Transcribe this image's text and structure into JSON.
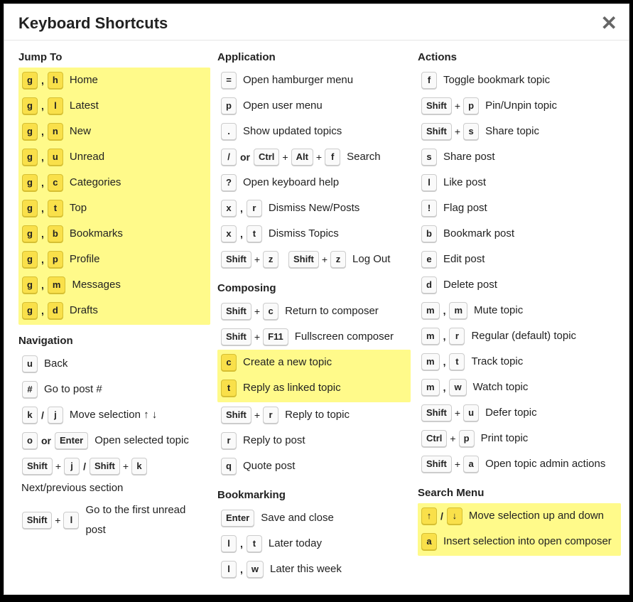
{
  "dialog": {
    "title": "Keyboard Shortcuts"
  },
  "sections": {
    "jumpTo": {
      "title": "Jump To",
      "rows": [
        {
          "keys": [
            [
              "g"
            ],
            [
              ","
            ],
            [
              "h"
            ]
          ],
          "desc": "Home",
          "hl": true
        },
        {
          "keys": [
            [
              "g"
            ],
            [
              ","
            ],
            [
              "l"
            ]
          ],
          "desc": "Latest",
          "hl": true
        },
        {
          "keys": [
            [
              "g"
            ],
            [
              ","
            ],
            [
              "n"
            ]
          ],
          "desc": "New",
          "hl": true
        },
        {
          "keys": [
            [
              "g"
            ],
            [
              ","
            ],
            [
              "u"
            ]
          ],
          "desc": "Unread",
          "hl": true
        },
        {
          "keys": [
            [
              "g"
            ],
            [
              ","
            ],
            [
              "c"
            ]
          ],
          "desc": "Categories",
          "hl": true
        },
        {
          "keys": [
            [
              "g"
            ],
            [
              ","
            ],
            [
              "t"
            ]
          ],
          "desc": "Top",
          "hl": true
        },
        {
          "keys": [
            [
              "g"
            ],
            [
              ","
            ],
            [
              "b"
            ]
          ],
          "desc": "Bookmarks",
          "hl": true
        },
        {
          "keys": [
            [
              "g"
            ],
            [
              ","
            ],
            [
              "p"
            ]
          ],
          "desc": "Profile",
          "hl": true
        },
        {
          "keys": [
            [
              "g"
            ],
            [
              ","
            ],
            [
              "m"
            ]
          ],
          "desc": "Messages",
          "hl": true
        },
        {
          "keys": [
            [
              "g"
            ],
            [
              ","
            ],
            [
              "d"
            ]
          ],
          "desc": "Drafts",
          "hl": true
        }
      ]
    },
    "navigation": {
      "title": "Navigation",
      "back": {
        "key": "u",
        "desc": "Back"
      },
      "goToPost": {
        "key": "#",
        "desc": "Go to post #"
      },
      "moveSel": {
        "k": "k",
        "j": "j",
        "slash": "/",
        "desc": "Move selection ↑ ↓"
      },
      "openSel": {
        "o": "o",
        "or": "or",
        "enter": "Enter",
        "desc": "Open selected topic"
      },
      "nextPrev": {
        "shift": "Shift",
        "plus": "+",
        "j": "j",
        "slash": "/",
        "k": "k",
        "desc": "Next/previous section"
      },
      "firstUnread": {
        "shift": "Shift",
        "plus": "+",
        "l": "l",
        "desc": "Go to the first unread post"
      }
    },
    "application": {
      "title": "Application",
      "rows": [
        {
          "k": "=",
          "desc": "Open hamburger menu"
        },
        {
          "k": "p",
          "desc": "Open user menu"
        },
        {
          "k": ".",
          "desc": "Show updated topics"
        }
      ],
      "search": {
        "slash": "/",
        "or": "or",
        "ctrl": "Ctrl",
        "plus": "+",
        "alt": "Alt",
        "f": "f",
        "desc": "Search"
      },
      "help": {
        "k": "?",
        "desc": "Open keyboard help"
      },
      "dismissNew": {
        "x": "x",
        "comma": ",",
        "r": "r",
        "desc": "Dismiss New/Posts"
      },
      "dismissTopics": {
        "x": "x",
        "comma": ",",
        "t": "t",
        "desc": "Dismiss Topics"
      },
      "logout": {
        "shift": "Shift",
        "plus": "+",
        "z": "z",
        "desc": "Log Out"
      }
    },
    "composing": {
      "title": "Composing",
      "returnComposer": {
        "shift": "Shift",
        "plus": "+",
        "c": "c",
        "desc": "Return to composer"
      },
      "fullscreen": {
        "shift": "Shift",
        "plus": "+",
        "f11": "F11",
        "desc": "Fullscreen composer"
      },
      "createTopic": {
        "k": "c",
        "desc": "Create a new topic",
        "hl": true
      },
      "replyLinked": {
        "k": "t",
        "desc": "Reply as linked topic",
        "hl": true
      },
      "replyTopic": {
        "shift": "Shift",
        "plus": "+",
        "r": "r",
        "desc": "Reply to topic"
      },
      "replyPost": {
        "k": "r",
        "desc": "Reply to post"
      },
      "quotePost": {
        "k": "q",
        "desc": "Quote post"
      }
    },
    "bookmarking": {
      "title": "Bookmarking",
      "saveClose": {
        "enter": "Enter",
        "desc": "Save and close"
      },
      "laterToday": {
        "l": "l",
        "comma": ",",
        "t": "t",
        "desc": "Later today"
      },
      "laterWeek": {
        "l": "l",
        "comma": ",",
        "w": "w",
        "desc": "Later this week"
      }
    },
    "actions": {
      "title": "Actions",
      "toggleBookmark": {
        "k": "f",
        "desc": "Toggle bookmark topic"
      },
      "pinUnpin": {
        "shift": "Shift",
        "plus": "+",
        "p": "p",
        "desc": "Pin/Unpin topic"
      },
      "shareTopic": {
        "shift": "Shift",
        "plus": "+",
        "s": "s",
        "desc": "Share topic"
      },
      "sharePost": {
        "k": "s",
        "desc": "Share post"
      },
      "likePost": {
        "k": "l",
        "desc": "Like post"
      },
      "flagPost": {
        "k": "!",
        "desc": "Flag post"
      },
      "bookmarkPost": {
        "k": "b",
        "desc": "Bookmark post"
      },
      "editPost": {
        "k": "e",
        "desc": "Edit post"
      },
      "deletePost": {
        "k": "d",
        "desc": "Delete post"
      },
      "muteTopic": {
        "m1": "m",
        "comma": ",",
        "m2": "m",
        "desc": "Mute topic"
      },
      "regularTopic": {
        "m": "m",
        "comma": ",",
        "r": "r",
        "desc": "Regular (default) topic"
      },
      "trackTopic": {
        "m": "m",
        "comma": ",",
        "t": "t",
        "desc": "Track topic"
      },
      "watchTopic": {
        "m": "m",
        "comma": ",",
        "w": "w",
        "desc": "Watch topic"
      },
      "deferTopic": {
        "shift": "Shift",
        "plus": "+",
        "u": "u",
        "desc": "Defer topic"
      },
      "printTopic": {
        "ctrl": "Ctrl",
        "plus": "+",
        "p": "p",
        "desc": "Print topic"
      },
      "adminActions": {
        "shift": "Shift",
        "plus": "+",
        "a": "a",
        "desc": "Open topic admin actions"
      }
    },
    "searchMenu": {
      "title": "Search Menu",
      "moveSel": {
        "up": "↑",
        "slash": "/",
        "down": "↓",
        "desc": "Move selection up and down",
        "hl": true
      },
      "insert": {
        "k": "a",
        "desc": "Insert selection into open composer",
        "hl": true
      }
    }
  }
}
